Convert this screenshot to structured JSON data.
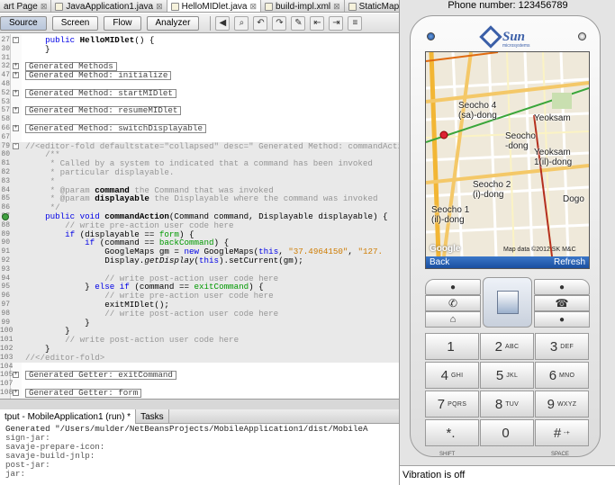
{
  "tabs": [
    {
      "label": "art Page"
    },
    {
      "label": "JavaApplication1.java"
    },
    {
      "label": "HelloMIDlet.java",
      "active": true
    },
    {
      "label": "build-impl.xml"
    },
    {
      "label": "StaticMapUtils."
    }
  ],
  "toolbar": {
    "source": "Source",
    "screen": "Screen",
    "flow": "Flow",
    "analyzer": "Analyzer"
  },
  "editor_lines": [
    {
      "n": "27",
      "fold": "-",
      "html": "    <span class='kw'>public</span> <span class='bold'>HelloMIDlet</span>() {"
    },
    {
      "n": "30",
      "fold": "",
      "html": "    }"
    },
    {
      "n": "31",
      "fold": "",
      "html": ""
    },
    {
      "n": "",
      "fold": "+",
      "html": "<span class='foldbox'>Generated Methods</span>"
    },
    {
      "n": "",
      "fold": "+",
      "html": "<span class='foldbox'>Generated Method: initialize</span>"
    },
    {
      "n": "",
      "fold": "",
      "html": ""
    },
    {
      "n": "",
      "fold": "+",
      "html": "<span class='foldbox'>Generated Method: startMIDlet</span>"
    },
    {
      "n": "",
      "fold": "",
      "html": ""
    },
    {
      "n": "",
      "fold": "+",
      "html": "<span class='foldbox'>Generated Method: resumeMIDlet</span>"
    },
    {
      "n": "",
      "fold": "",
      "html": ""
    },
    {
      "n": "",
      "fold": "+",
      "html": "<span class='foldbox'>Generated Method: switchDisplayable</span>"
    },
    {
      "n": "",
      "fold": "",
      "html": ""
    },
    {
      "n": "",
      "fold": "-",
      "guard": true,
      "html": "<span class='cm'>//&lt;editor-fold defaultstate=\"collapsed\" desc=\" Generated Method: commandAction\"&gt;</span>"
    },
    {
      "n": "",
      "fold": "",
      "guard": true,
      "html": "    <span class='cm'>/**</span>"
    },
    {
      "n": "",
      "fold": "",
      "guard": true,
      "html": "<span class='cm'>     * Called by a system to indicated that a command has been invoked</span>"
    },
    {
      "n": "",
      "fold": "",
      "guard": true,
      "html": "<span class='cm'>     * particular displayable.</span>"
    },
    {
      "n": "",
      "fold": "",
      "guard": true,
      "html": "<span class='cm'>     *</span>"
    },
    {
      "n": "",
      "fold": "",
      "guard": true,
      "html": "<span class='cm'>     * @param </span><span class='bold'>command</span><span class='cm'> the Command that was invoked</span>"
    },
    {
      "n": "",
      "fold": "",
      "guard": true,
      "html": "<span class='cm'>     * @param </span><span class='bold'>displayable</span><span class='cm'> the Displayable where the command was invoked</span>"
    },
    {
      "n": "",
      "fold": "",
      "guard": true,
      "html": "<span class='cm'>     */</span>"
    },
    {
      "n": "",
      "fold": "",
      "guard": true,
      "html": "    <span class='kw'>public void</span> <span class='bold'>commandAction</span>(Command command, Displayable displayable) {"
    },
    {
      "n": "",
      "fold": "",
      "guard": true,
      "html": "        <span class='cm'>// write pre-action user code here</span>"
    },
    {
      "n": "",
      "fold": "",
      "guard": true,
      "html": "        <span class='kw'>if</span> (displayable == <span class='fld'>form</span>) {"
    },
    {
      "n": "",
      "fold": "",
      "guard": true,
      "html": "            <span class='kw'>if</span> (command == <span class='fld'>backCommand</span>) {"
    },
    {
      "n": "",
      "fold": "",
      "guard": true,
      "html": "                GoogleMaps gm = <span class='kw'>new</span> GoogleMaps(<span class='kw'>this</span>, <span class='st'>\"37.4964150\"</span>, <span class='st'>\"127.</span>"
    },
    {
      "n": "",
      "fold": "",
      "guard": true,
      "html": "                Display.<span class='it'>getDisplay</span>(<span class='kw'>this</span>).setCurrent(gm);"
    },
    {
      "n": "",
      "fold": "",
      "guard": true,
      "html": ""
    },
    {
      "n": "",
      "fold": "",
      "guard": true,
      "html": "                <span class='cm'>// write post-action user code here</span>"
    },
    {
      "n": "",
      "fold": "",
      "guard": true,
      "html": "            } <span class='kw'>else if</span> (command == <span class='fld'>exitCommand</span>) {"
    },
    {
      "n": "",
      "fold": "",
      "guard": true,
      "html": "                <span class='cm'>// write pre-action user code here</span>"
    },
    {
      "n": "",
      "fold": "",
      "guard": true,
      "html": "                exitMIDlet();"
    },
    {
      "n": "",
      "fold": "",
      "guard": true,
      "html": "                <span class='cm'>// write post-action user code here</span>"
    },
    {
      "n": "",
      "fold": "",
      "guard": true,
      "html": "            }"
    },
    {
      "n": "",
      "fold": "",
      "guard": true,
      "html": "        }"
    },
    {
      "n": "",
      "fold": "",
      "guard": true,
      "html": "        <span class='cm'>// write post-action user code here</span>"
    },
    {
      "n": "",
      "fold": "",
      "guard": true,
      "html": "    }"
    },
    {
      "n": "",
      "fold": "",
      "guard": true,
      "html": "<span class='cm'>//&lt;/editor-fold&gt;</span>"
    },
    {
      "n": "",
      "fold": "",
      "html": ""
    },
    {
      "n": "",
      "fold": "+",
      "html": "<span class='foldbox'>Generated Getter: exitCommand</span>"
    },
    {
      "n": "",
      "fold": "",
      "html": ""
    },
    {
      "n": "",
      "fold": "+",
      "html": "<span class='foldbox'>Generated Getter: form</span>"
    }
  ],
  "output_tabs": [
    {
      "label": "tput - MobileApplication1 (run) *"
    },
    {
      "label": "Tasks"
    }
  ],
  "output_lines": [
    "Generated \"/Users/mulder/NetBeansProjects/MobileApplication1/dist/MobileA",
    "sign-jar:",
    "savaje-prepare-icon:",
    "savaje-build-jnlp:",
    "post-jar:",
    "jar:"
  ],
  "emulator": {
    "phone_number": "Phone number: 123456789",
    "brand": "Sun",
    "brand_sub": "microsystems",
    "softkey_left": "Back",
    "softkey_right": "Refresh",
    "map_labels": [
      "Seocho 4\n(sa)-dong",
      "Yeoksam",
      "Seocho\n-dong",
      "Yeoksam\n1(il)-dong",
      "Seocho 2\n(i)-dong",
      "Dogo",
      "Seocho 1\n(il)-dong"
    ],
    "map_credit": "Map data ©2012 SK M&C",
    "map_google": "Google",
    "vibration": "Vibration is off",
    "keys": [
      {
        "d": "1",
        "l": ""
      },
      {
        "d": "2",
        "l": "ABC"
      },
      {
        "d": "3",
        "l": "DEF"
      },
      {
        "d": "4",
        "l": "GHI"
      },
      {
        "d": "5",
        "l": "JKL"
      },
      {
        "d": "6",
        "l": "MNO"
      },
      {
        "d": "7",
        "l": "PQRS"
      },
      {
        "d": "8",
        "l": "TUV"
      },
      {
        "d": "9",
        "l": "WXYZ"
      },
      {
        "d": "*.",
        "l": ""
      },
      {
        "d": "0",
        "l": ""
      },
      {
        "d": "#",
        "l": "-+"
      }
    ],
    "shift_label": "SHIFT",
    "space_label": "SPACE"
  }
}
